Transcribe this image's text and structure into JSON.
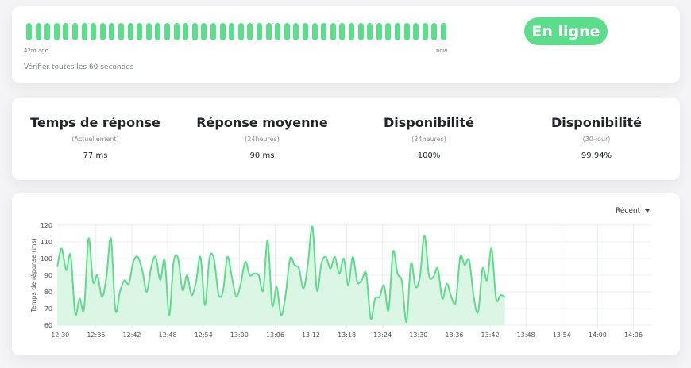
{
  "heartbeat": {
    "bar_count": 46,
    "bar_statuses": [
      "up",
      "up",
      "up",
      "up",
      "up",
      "up",
      "up",
      "up",
      "up",
      "up",
      "up",
      "up",
      "up",
      "up",
      "up",
      "up",
      "up",
      "up",
      "up",
      "up",
      "up",
      "up",
      "up",
      "up",
      "up",
      "up",
      "up",
      "up",
      "up",
      "up",
      "up",
      "up",
      "up",
      "up",
      "up",
      "up",
      "up",
      "up",
      "up",
      "up",
      "up",
      "up",
      "up",
      "up",
      "up",
      "up"
    ],
    "start_label": "42m ago",
    "end_label": "now",
    "interval_text": "Vérifier toutes les 60 secondes"
  },
  "status": {
    "label": "En ligne"
  },
  "stats": [
    {
      "title": "Temps de réponse",
      "subtitle": "(Actuellement)",
      "value": "77 ms"
    },
    {
      "title": "Réponse moyenne",
      "subtitle": "(24heures)",
      "value": "90 ms"
    },
    {
      "title": "Disponibilité",
      "subtitle": "(24heures)",
      "value": "100%"
    },
    {
      "title": "Disponibilité",
      "subtitle": "(30-jour)",
      "value": "99.94%"
    }
  ],
  "period_select": {
    "selected": "Récent"
  },
  "colors": {
    "accent": "#5cdd8b",
    "accent_fill": "#dcf6e6",
    "grid": "#e9ecef",
    "text_muted": "#7a7f86"
  },
  "chart_data": {
    "type": "area",
    "ylabel": "Temps de réponse (ms)",
    "ylim": [
      60,
      120
    ],
    "yticks": [
      60,
      70,
      80,
      90,
      100,
      110,
      120
    ],
    "x_start": "12:29:30",
    "x_end": "14:09:00",
    "xticks": [
      "12:30",
      "12:36",
      "12:42",
      "12:48",
      "12:54",
      "13:00",
      "13:06",
      "13:12",
      "13:18",
      "13:24",
      "13:30",
      "13:36",
      "13:42",
      "13:48",
      "13:54",
      "14:00",
      "14:06"
    ],
    "grid": true,
    "series": [
      {
        "points": [
          [
            "12:29:30",
            95
          ],
          [
            "12:30:15",
            106
          ],
          [
            "12:31:00",
            93
          ],
          [
            "12:31:45",
            102
          ],
          [
            "12:32:30",
            67
          ],
          [
            "12:33:15",
            76
          ],
          [
            "12:34:00",
            70
          ],
          [
            "12:34:45",
            112
          ],
          [
            "12:35:30",
            86
          ],
          [
            "12:36:15",
            90
          ],
          [
            "12:37:00",
            77
          ],
          [
            "12:37:45",
            89
          ],
          [
            "12:38:30",
            112
          ],
          [
            "12:39:15",
            69
          ],
          [
            "12:40:00",
            80
          ],
          [
            "12:40:45",
            87
          ],
          [
            "12:41:30",
            85
          ],
          [
            "12:42:15",
            98
          ],
          [
            "12:43:00",
            101
          ],
          [
            "12:43:45",
            93
          ],
          [
            "12:44:30",
            80
          ],
          [
            "12:45:15",
            95
          ],
          [
            "12:46:00",
            101
          ],
          [
            "12:46:45",
            87
          ],
          [
            "12:47:30",
            99
          ],
          [
            "12:48:15",
            66
          ],
          [
            "12:49:00",
            98
          ],
          [
            "12:49:45",
            100
          ],
          [
            "12:50:30",
            81
          ],
          [
            "12:51:15",
            90
          ],
          [
            "12:52:00",
            78
          ],
          [
            "12:52:45",
            86
          ],
          [
            "12:53:30",
            101
          ],
          [
            "12:54:15",
            72
          ],
          [
            "12:55:00",
            100
          ],
          [
            "12:55:45",
            100
          ],
          [
            "12:56:30",
            79
          ],
          [
            "12:57:15",
            80
          ],
          [
            "12:58:00",
            101
          ],
          [
            "12:58:45",
            89
          ],
          [
            "12:59:30",
            77
          ],
          [
            "13:00:15",
            85
          ],
          [
            "13:01:00",
            98
          ],
          [
            "13:01:45",
            90
          ],
          [
            "13:02:30",
            91
          ],
          [
            "13:03:15",
            90
          ],
          [
            "13:04:00",
            81
          ],
          [
            "13:04:45",
            111
          ],
          [
            "13:05:30",
            72
          ],
          [
            "13:06:15",
            83
          ],
          [
            "13:07:00",
            66
          ],
          [
            "13:07:45",
            78
          ],
          [
            "13:08:30",
            100
          ],
          [
            "13:09:15",
            96
          ],
          [
            "13:10:00",
            94
          ],
          [
            "13:10:45",
            82
          ],
          [
            "13:11:30",
            97
          ],
          [
            "13:12:15",
            119
          ],
          [
            "13:13:00",
            81
          ],
          [
            "13:13:45",
            97
          ],
          [
            "13:14:30",
            101
          ],
          [
            "13:15:15",
            94
          ],
          [
            "13:16:00",
            101
          ],
          [
            "13:16:45",
            91
          ],
          [
            "13:17:30",
            100
          ],
          [
            "13:18:15",
            84
          ],
          [
            "13:19:00",
            101
          ],
          [
            "13:19:45",
            86
          ],
          [
            "13:20:30",
            87
          ],
          [
            "13:21:15",
            91
          ],
          [
            "13:22:00",
            64
          ],
          [
            "13:22:45",
            76
          ],
          [
            "13:23:30",
            77
          ],
          [
            "13:24:15",
            84
          ],
          [
            "13:25:00",
            69
          ],
          [
            "13:25:45",
            104
          ],
          [
            "13:26:30",
            91
          ],
          [
            "13:27:15",
            86
          ],
          [
            "13:28:00",
            62
          ],
          [
            "13:28:45",
            97
          ],
          [
            "13:29:30",
            83
          ],
          [
            "13:30:15",
            89
          ],
          [
            "13:31:00",
            114
          ],
          [
            "13:31:45",
            90
          ],
          [
            "13:32:30",
            89
          ],
          [
            "13:33:15",
            94
          ],
          [
            "13:34:00",
            76
          ],
          [
            "13:34:45",
            85
          ],
          [
            "13:35:30",
            77
          ],
          [
            "13:36:15",
            74
          ],
          [
            "13:37:00",
            101
          ],
          [
            "13:37:45",
            96
          ],
          [
            "13:38:30",
            99
          ],
          [
            "13:39:15",
            77
          ],
          [
            "13:40:00",
            68
          ],
          [
            "13:40:45",
            94
          ],
          [
            "13:41:30",
            87
          ],
          [
            "13:42:15",
            106
          ],
          [
            "13:43:00",
            76
          ],
          [
            "13:43:45",
            78
          ],
          [
            "13:44:30",
            77
          ]
        ]
      }
    ]
  }
}
